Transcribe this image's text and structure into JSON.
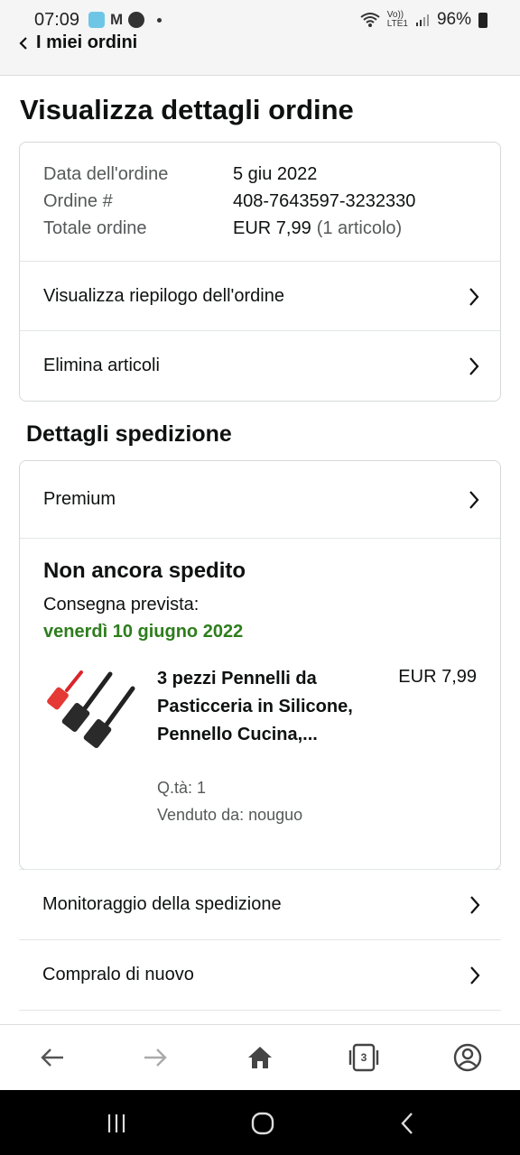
{
  "status_bar": {
    "time": "07:09",
    "gmail": "M",
    "network_top": "Vo))",
    "network_bottom": "LTE1",
    "battery": "96%"
  },
  "nav": {
    "back_label": "I miei ordini"
  },
  "page_title": "Visualizza dettagli ordine",
  "order_info": {
    "date_label": "Data dell'ordine",
    "date_value": "5 giu 2022",
    "number_label": "Ordine #",
    "number_value": "408-7643597-3232330",
    "total_label": "Totale ordine",
    "total_value": "EUR 7,99",
    "total_items": "(1 articolo)"
  },
  "order_actions": {
    "summary": "Visualizza riepilogo dell'ordine",
    "delete": "Elimina articoli"
  },
  "shipping": {
    "section_title": "Dettagli spedizione",
    "method": "Premium",
    "status": "Non ancora spedito",
    "delivery_label": "Consegna prevista:",
    "delivery_date": "venerdì 10 giugno 2022",
    "product": {
      "title": "3 pezzi Pennelli da Pasticceria in Silicone, Pennello Cucina,...",
      "price": "EUR 7,99",
      "qty": "Q.tà: 1",
      "seller": "Venduto da: nouguo"
    }
  },
  "links": {
    "tracking": "Monitoraggio della spedizione",
    "buy_again": "Compralo di nuovo"
  },
  "browser_bar": {
    "tabs_count": "3"
  },
  "colors": {
    "delivery_green": "#2e7d1d",
    "text_primary": "#0f1111",
    "text_secondary": "#565959",
    "border": "#d5d9d9"
  },
  "icons": [
    "back-arrow-icon",
    "forward-arrow-icon",
    "home-icon",
    "tabs-icon",
    "account-icon",
    "chevron-right-icon"
  ]
}
